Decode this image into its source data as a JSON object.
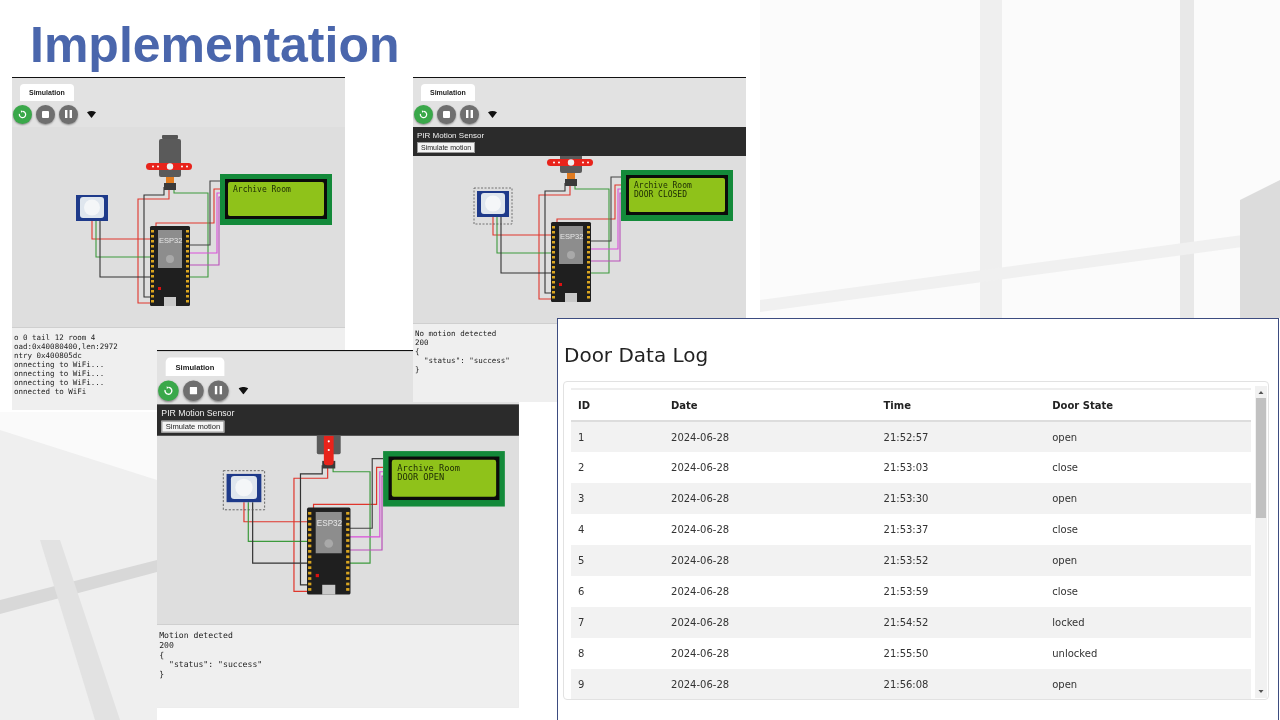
{
  "slide_title": "Implementation",
  "simulations": [
    {
      "tab": "Simulation",
      "pir_selected": false,
      "servo_open": false,
      "board_label": "ESP32",
      "lcd_lines": [
        "Archive Room"
      ],
      "console": [
        "o 0 tail 12 room 4",
        "oad:0x40080400,len:2972",
        "ntry 0x400805dc",
        "onnecting to WiFi...",
        "onnecting to WiFi...",
        "onnecting to WiFi...",
        "onnected to WiFi"
      ]
    },
    {
      "tab": "Simulation",
      "sensor_panel": {
        "title": "PIR Motion Sensor",
        "button": "Simulate motion"
      },
      "pir_selected": true,
      "servo_open": false,
      "board_label": "ESP32",
      "lcd_lines": [
        "Archive Room",
        "DOOR CLOSED"
      ],
      "console": [
        "No motion detected",
        "200",
        "{",
        "  \"status\": \"success\"",
        "}"
      ]
    },
    {
      "tab": "Simulation",
      "sensor_panel": {
        "title": "PIR Motion Sensor",
        "button": "Simulate motion"
      },
      "pir_selected": true,
      "servo_open": true,
      "board_label": "ESP32",
      "lcd_lines": [
        "Archive Room",
        "DOOR OPEN"
      ],
      "console": [
        "Motion detected",
        "200",
        "{",
        "  \"status\": \"success\"",
        "}"
      ]
    }
  ],
  "door_log": {
    "title": "Door Data Log",
    "columns": [
      "ID",
      "Date",
      "Time",
      "Door State"
    ],
    "rows": [
      [
        "1",
        "2024-06-28",
        "21:52:57",
        "open"
      ],
      [
        "2",
        "2024-06-28",
        "21:53:03",
        "close"
      ],
      [
        "3",
        "2024-06-28",
        "21:53:30",
        "open"
      ],
      [
        "4",
        "2024-06-28",
        "21:53:37",
        "close"
      ],
      [
        "5",
        "2024-06-28",
        "21:53:52",
        "open"
      ],
      [
        "6",
        "2024-06-28",
        "21:53:59",
        "close"
      ],
      [
        "7",
        "2024-06-28",
        "21:54:52",
        "locked"
      ],
      [
        "8",
        "2024-06-28",
        "21:55:50",
        "unlocked"
      ],
      [
        "9",
        "2024-06-28",
        "21:56:08",
        "open"
      ]
    ]
  }
}
